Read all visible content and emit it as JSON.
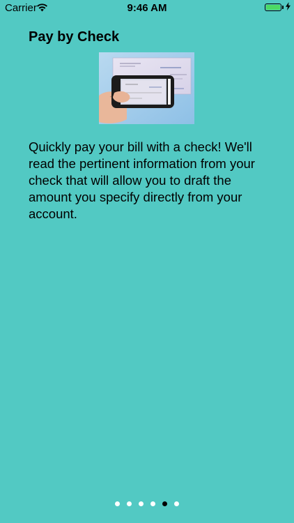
{
  "status_bar": {
    "carrier": "Carrier",
    "time": "9:46 AM",
    "icons": [
      "wifi-icon",
      "battery-icon",
      "charging-bolt-icon"
    ],
    "battery_color": "#4CD964"
  },
  "screen": {
    "background_color": "#52C9C3",
    "title": "Pay by Check",
    "image": "phone-scanning-check-image",
    "description": "Quickly pay your bill with a check!  We'll read the pertinent information from your check that will allow you to draft the amount you specify directly from your account."
  },
  "pager": {
    "page_count": 6,
    "current_page": 5
  }
}
